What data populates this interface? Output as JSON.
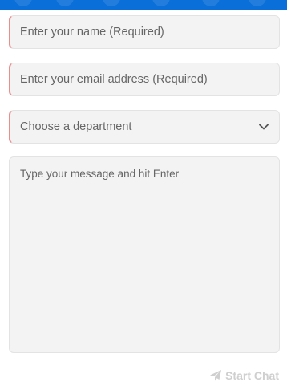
{
  "form": {
    "name_placeholder": "Enter your name (Required)",
    "email_placeholder": "Enter your email address (Required)",
    "department_selected": "Choose a department",
    "message_placeholder": "Type your message and hit Enter",
    "start_chat_label": "Start Chat"
  },
  "icons": {
    "department_dropdown": "chevron-down-icon",
    "start_chat": "paper-plane-icon"
  },
  "colors": {
    "header_blue": "#0a6fd8",
    "required_marker": "#ee8c8c",
    "field_background": "#f3f3f3",
    "disabled_button_text": "#cfcfcf"
  }
}
